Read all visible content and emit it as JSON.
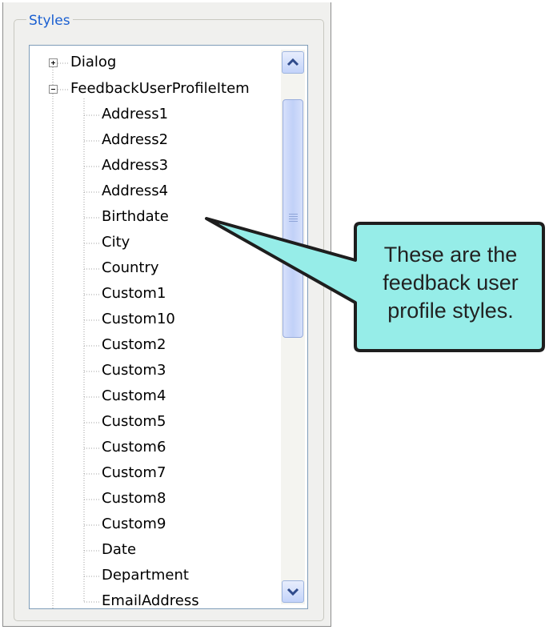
{
  "group": {
    "title": "Styles"
  },
  "tree": {
    "root_nodes": [
      {
        "label": "Dialog",
        "expanded": false
      },
      {
        "label": "FeedbackUserProfileItem",
        "expanded": true
      }
    ],
    "children": [
      "Address1",
      "Address2",
      "Address3",
      "Address4",
      "Birthdate",
      "City",
      "Country",
      "Custom1",
      "Custom10",
      "Custom2",
      "Custom3",
      "Custom4",
      "Custom5",
      "Custom6",
      "Custom7",
      "Custom8",
      "Custom9",
      "Date",
      "Department",
      "EmailAddress"
    ]
  },
  "callout": {
    "lines": [
      "These are the",
      "feedback user",
      "profile styles."
    ],
    "fill": "#96ede8",
    "border": "#1e1e1e"
  },
  "scrollbar": {
    "up_icon": "chevron-up-icon",
    "down_icon": "chevron-down-icon"
  }
}
